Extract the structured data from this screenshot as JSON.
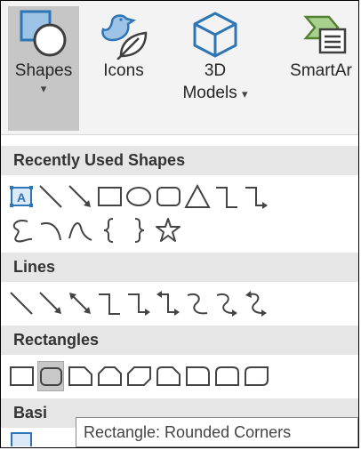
{
  "ribbon": {
    "shapes": {
      "label": "Shapes",
      "caret": "▾"
    },
    "icons": {
      "label": "Icons"
    },
    "models": {
      "label_line1": "3D",
      "label_line2": "Models",
      "caret": "▾"
    },
    "smartart": {
      "label": "SmartAr"
    }
  },
  "gallery": {
    "sections": {
      "recent": "Recently Used Shapes",
      "lines": "Lines",
      "rectangles": "Rectangles",
      "basic": "Basi"
    },
    "selected_shape": "Rectangle: Rounded Corners"
  },
  "tooltip": {
    "text": "Rectangle: Rounded Corners"
  },
  "colors": {
    "accent": "#2e75b6",
    "icon_fill": "#9dc3e6",
    "selected_bg": "#c6c6c6",
    "section_bg": "#e6e6e6"
  }
}
